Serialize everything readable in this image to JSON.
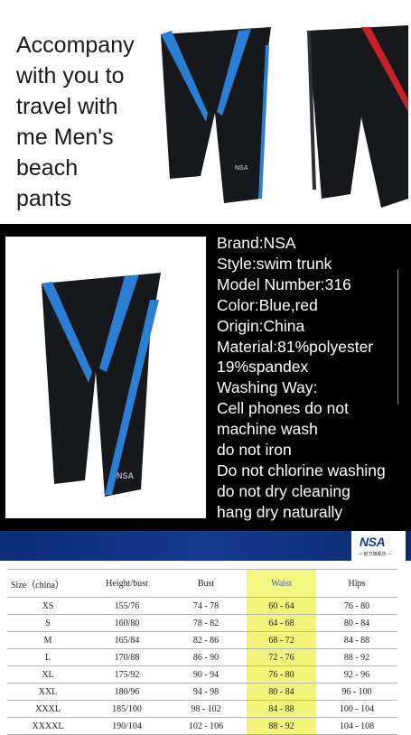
{
  "banner": {
    "title": "Accompany\nwith you to\ntravel with\nme Men's\nbeach\npants"
  },
  "product": {
    "logo_print": "NSA"
  },
  "specs": [
    "Brand:NSA",
    "Style:swim trunk",
    "Model Number:316",
    "Color:Blue,red",
    "Origin:China",
    "Material:81%polyester",
    "19%spandex",
    "Washing Way:",
    "Cell phones do not",
    "machine wash",
    "do not iron",
    "Do not chlorine washing",
    "do not dry cleaning",
    "hang dry naturally"
  ],
  "brand_bar": {
    "logo": "NSA",
    "logo_sub": "— 官方旗舰店 —"
  },
  "size_table": {
    "headers": [
      "Size（china）",
      "Height/bust",
      "Bust",
      "Waist",
      "Hips"
    ],
    "rows": [
      [
        "XS",
        "155/76",
        "74 - 78",
        "60 - 64",
        "76 - 80"
      ],
      [
        "S",
        "160/80",
        "78 - 82",
        "64 - 68",
        "80 - 84"
      ],
      [
        "M",
        "165/84",
        "82 - 86",
        "68 - 72",
        "84 - 88"
      ],
      [
        "L",
        "170/88",
        "86 - 90",
        "72 - 76",
        "88 - 92"
      ],
      [
        "XL",
        "175/92",
        "90 - 94",
        "76 - 80",
        "92 - 96"
      ],
      [
        "XXL",
        "180/96",
        "94 - 98",
        "80 - 84",
        "96 - 100"
      ],
      [
        "XXXL",
        "185/100",
        "98 - 102",
        "84 - 88",
        "100 - 104"
      ],
      [
        "XXXXL",
        "190/104",
        "102 - 106",
        "88 - 92",
        "104 - 108"
      ]
    ]
  },
  "colors": {
    "fabric": "#16181c",
    "accent_blue": "#2a7fd4",
    "accent_red": "#c8202b",
    "bar_blue": "#153b8e",
    "waist_highlight": "#f2f57a"
  }
}
